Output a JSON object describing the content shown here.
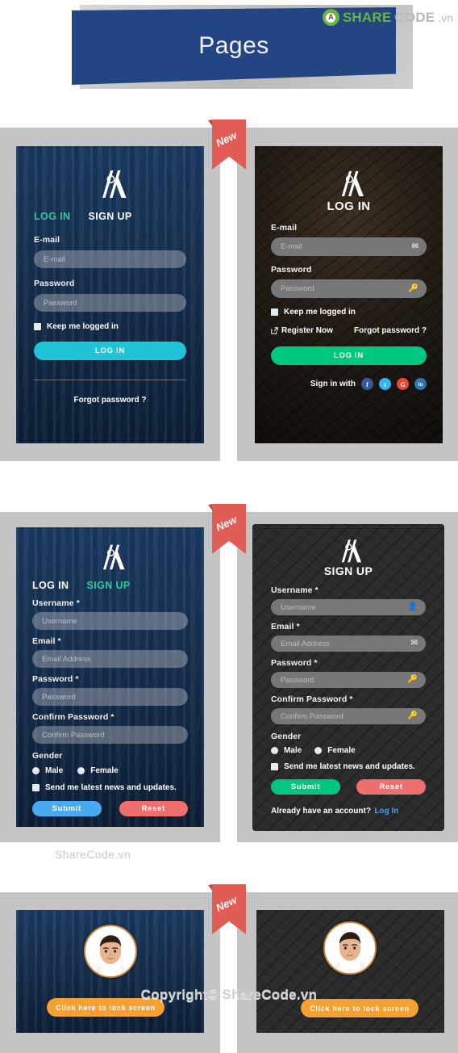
{
  "header": {
    "title": "Pages",
    "brand": {
      "share": "SHARE",
      "code": "CODE",
      "tld": ".vn",
      "mark_letter": "A"
    }
  },
  "badge": {
    "label": "New"
  },
  "watermarks": {
    "sharecode": "ShareCode.vn",
    "copyright": "Copyright© ShareCode.vn"
  },
  "login_light": {
    "tabs": [
      {
        "label": "LOG IN",
        "active": true
      },
      {
        "label": "SIGN UP",
        "active": false
      }
    ],
    "fields": [
      {
        "label": "E-mail",
        "placeholder": "E-mail"
      },
      {
        "label": "Password",
        "placeholder": "Password"
      }
    ],
    "checkbox_label": "Keep me logged in",
    "submit_label": "LOG IN",
    "forgot_label": "Forgot password ?"
  },
  "login_dark": {
    "title": "LOG IN",
    "fields": [
      {
        "label": "E-mail",
        "placeholder": "E-mail",
        "icon": "envelope-icon"
      },
      {
        "label": "Password",
        "placeholder": "Password",
        "icon": "key-icon"
      }
    ],
    "checkbox_label": "Keep me logged in",
    "register_label": "Register Now",
    "forgot_label": "Forgot password ?",
    "submit_label": "LOG IN",
    "social_prompt": "Sign in with",
    "social": [
      {
        "name": "facebook-icon",
        "glyph": "f",
        "color": "#3b5998"
      },
      {
        "name": "twitter-icon",
        "glyph": "t",
        "color": "#3ab3f0"
      },
      {
        "name": "google-plus-icon",
        "glyph": "G",
        "color": "#dd4b39"
      },
      {
        "name": "linkedin-icon",
        "glyph": "in",
        "color": "#3475b0"
      }
    ]
  },
  "signup_light": {
    "tabs": [
      {
        "label": "LOG IN",
        "active": false
      },
      {
        "label": "SIGN UP",
        "active": true
      }
    ],
    "fields": [
      {
        "label": "Username *",
        "placeholder": "Username"
      },
      {
        "label": "Email *",
        "placeholder": "Email Address"
      },
      {
        "label": "Password *",
        "placeholder": "Password"
      },
      {
        "label": "Confirm Password *",
        "placeholder": "Confirm Password"
      }
    ],
    "gender_label": "Gender",
    "gender_options": [
      "Male",
      "Female"
    ],
    "newsletter_label": "Send me latest news and updates.",
    "submit_label": "Submit",
    "reset_label": "Reset"
  },
  "signup_dark": {
    "title": "SIGN UP",
    "fields": [
      {
        "label": "Username *",
        "placeholder": "Username",
        "icon": "user-icon"
      },
      {
        "label": "Email *",
        "placeholder": "Email Address",
        "icon": "envelope-icon"
      },
      {
        "label": "Password *",
        "placeholder": "Password",
        "icon": "key-icon"
      },
      {
        "label": "Confirm Password *",
        "placeholder": "Confirm Password",
        "icon": "key-icon"
      }
    ],
    "gender_label": "Gender",
    "gender_options": [
      "Male",
      "Female"
    ],
    "newsletter_label": "Send me latest news and updates.",
    "submit_label": "Submit",
    "reset_label": "Reset",
    "account_prompt": "Already have an account?",
    "account_link": "Log In"
  },
  "lock_light": {
    "button_label": "Click here to lock screen"
  },
  "lock_dark": {
    "button_label": "Click here to lock screen"
  },
  "colors": {
    "banner_blue": "#234583",
    "accent_cyan": "#21c3d6",
    "accent_green": "#00c77f",
    "accent_blue": "#4aaaf0",
    "accent_red": "#ef6e6e",
    "accent_orange": "#f5a032",
    "tab_active": "#2ecc9b",
    "gray_panel": "#c4c4c4"
  }
}
